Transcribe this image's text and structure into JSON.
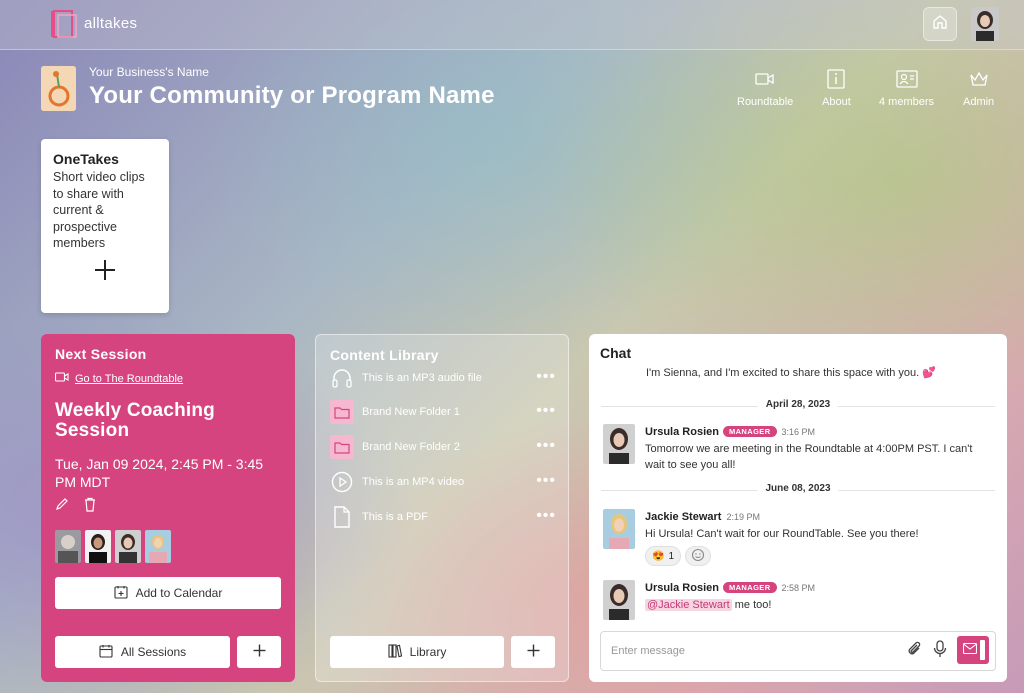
{
  "app": {
    "logo_text": "alltakes",
    "brand_color": "#d6447f"
  },
  "topbar": {
    "home_icon": "home-icon",
    "avatar": "user-avatar"
  },
  "header": {
    "business_name": "Your Business's Name",
    "community_name": "Your Community or Program Name",
    "nav": [
      {
        "label": "Roundtable",
        "icon": "video-icon"
      },
      {
        "label": "About",
        "icon": "info-icon"
      },
      {
        "label": "4 members",
        "icon": "members-icon"
      },
      {
        "label": "Admin",
        "icon": "crown-icon"
      }
    ]
  },
  "onetakes": {
    "title": "OneTakes",
    "description": "Short video clips to share with current & prospective members",
    "add_icon": "plus-icon"
  },
  "next_session": {
    "label": "Next Session",
    "goto_link": "Go to The Roundtable",
    "title": "Weekly Coaching Session",
    "datetime": "Tue, Jan 09 2024, 2:45 PM - 3:45 PM MDT",
    "add_to_calendar": "Add to Calendar",
    "all_sessions": "All Sessions"
  },
  "content_library": {
    "label": "Content Library",
    "items": [
      {
        "label": "This is an MP3 audio file",
        "icon": "headphones-icon"
      },
      {
        "label": "Brand New Folder 1",
        "icon": "folder-icon"
      },
      {
        "label": "Brand New Folder 2",
        "icon": "folder-icon"
      },
      {
        "label": "This is an MP4 video",
        "icon": "play-icon"
      },
      {
        "label": "This is a PDF",
        "icon": "file-icon"
      }
    ],
    "more": "•••",
    "library_button": "Library"
  },
  "chat": {
    "label": "Chat",
    "intro": "I'm Sienna, and I'm excited to share this space with you. 💕",
    "dates": [
      "April 28, 2023",
      "June 08, 2023"
    ],
    "messages": [
      {
        "name": "Ursula Rosien",
        "badge": "MANAGER",
        "time": "3:16 PM",
        "text": "Tomorrow we are meeting in the Roundtable at 4:00PM PST. I can't wait to see you all!"
      },
      {
        "name": "Jackie Stewart",
        "time": "2:19 PM",
        "text": "Hi Ursula! Can't wait for our RoundTable. See you there!",
        "reaction_emoji": "😍",
        "reaction_count": "1"
      },
      {
        "name": "Ursula Rosien",
        "badge": "MANAGER",
        "time": "2:58 PM",
        "mention": "@Jackie Stewart",
        "text": " me too!"
      }
    ],
    "input_placeholder": "Enter message"
  }
}
